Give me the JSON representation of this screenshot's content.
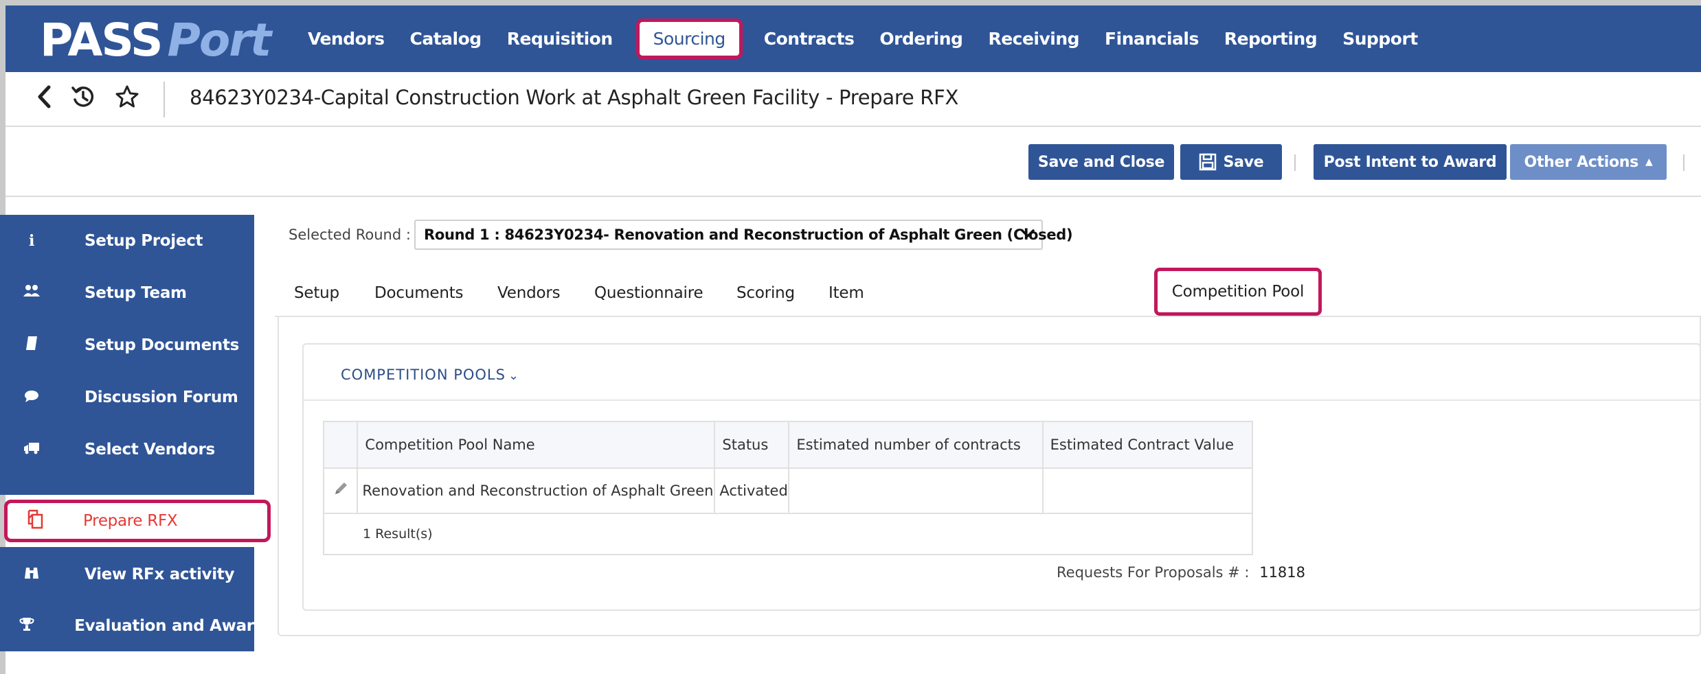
{
  "app": {
    "logo_pass": "PASS",
    "logo_port": "Port"
  },
  "nav": [
    {
      "label": "Vendors"
    },
    {
      "label": "Catalog"
    },
    {
      "label": "Requisition"
    },
    {
      "label": "Sourcing",
      "active": true
    },
    {
      "label": "Contracts"
    },
    {
      "label": "Ordering"
    },
    {
      "label": "Receiving"
    },
    {
      "label": "Financials"
    },
    {
      "label": "Reporting"
    },
    {
      "label": "Support"
    }
  ],
  "breadcrumb": {
    "icons": [
      "back-chevron-icon",
      "history-icon",
      "star-icon"
    ],
    "title": "84623Y0234-Capital Construction Work at Asphalt Green Facility - Prepare RFX"
  },
  "toolbar": {
    "save_close": "Save and Close",
    "save": "Save",
    "save_icon": "💾",
    "post_intent": "Post Intent to Award",
    "other_actions": "Other Actions",
    "other_actions_caret": "▲"
  },
  "sidebar": {
    "items": [
      {
        "icon": "info-icon",
        "glyph": "i",
        "label": "Setup Project"
      },
      {
        "icon": "team-icon",
        "glyph": "👥",
        "label": "Setup Team"
      },
      {
        "icon": "book-icon",
        "glyph": "▰",
        "label": "Setup Documents"
      },
      {
        "icon": "comment-icon",
        "glyph": "●",
        "label": "Discussion Forum"
      },
      {
        "icon": "truck-icon",
        "glyph": "⛟",
        "label": "Select Vendors"
      },
      {
        "icon": "copy-icon",
        "glyph": "⧉",
        "label": "Prepare RFX",
        "active": true
      },
      {
        "icon": "binoculars-icon",
        "glyph": "⚲",
        "label": "View RFx activity"
      },
      {
        "icon": "trophy-icon",
        "glyph": "🏆",
        "label": "Evaluation and Award"
      }
    ]
  },
  "round": {
    "label": "Selected Round :",
    "value": "Round 1 : 84623Y0234- Renovation and Reconstruction of Asphalt Green (Closed)",
    "chevron": "❯"
  },
  "tabs": [
    {
      "label": "Setup"
    },
    {
      "label": "Documents"
    },
    {
      "label": "Vendors"
    },
    {
      "label": "Questionnaire"
    },
    {
      "label": "Scoring"
    },
    {
      "label": "Item"
    },
    {
      "label": "Competition Pool",
      "active": true
    }
  ],
  "pools": {
    "title": "COMPETITION POOLS",
    "title_caret": "⌄",
    "columns": [
      "Competition Pool Name",
      "Status",
      "Estimated number of contracts",
      "Estimated Contract Value"
    ],
    "rows": [
      {
        "name": "Renovation and Reconstruction of Asphalt Green",
        "status": "Activated",
        "num_contracts": "",
        "value": ""
      }
    ],
    "results": "1 Result(s)"
  },
  "rfp": {
    "label": "Requests For Proposals # :",
    "number": "11818"
  },
  "colors": {
    "brand": "#2f5597",
    "highlight": "#c2185b",
    "active_text": "#e53935"
  }
}
